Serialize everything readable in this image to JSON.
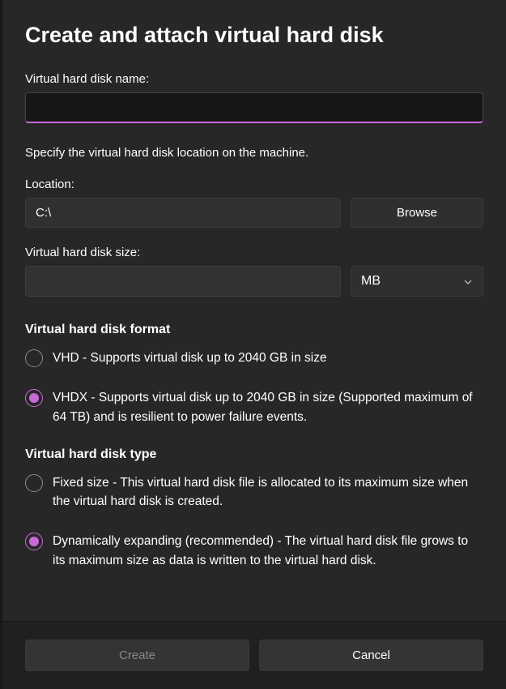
{
  "title": "Create and attach virtual hard disk",
  "nameField": {
    "label": "Virtual hard disk name:",
    "value": ""
  },
  "helperText": "Specify the virtual hard disk location on the machine.",
  "locationField": {
    "label": "Location:",
    "value": "C:\\",
    "browseLabel": "Browse"
  },
  "sizeField": {
    "label": "Virtual hard disk size:",
    "value": "",
    "unit": "MB"
  },
  "formatSection": {
    "title": "Virtual hard disk format",
    "options": [
      {
        "label": "VHD - Supports virtual disk up to 2040 GB in size",
        "selected": false
      },
      {
        "label": "VHDX - Supports virtual disk up to 2040 GB in size (Supported maximum of 64 TB) and is resilient to power failure events.",
        "selected": true
      }
    ]
  },
  "typeSection": {
    "title": "Virtual hard disk type",
    "options": [
      {
        "label": "Fixed size - This virtual hard disk file is allocated to its maximum size when the virtual hard disk is created.",
        "selected": false
      },
      {
        "label": "Dynamically expanding (recommended) - The virtual hard disk file grows to its maximum size as data is written to the virtual hard disk.",
        "selected": true
      }
    ]
  },
  "footer": {
    "create": "Create",
    "cancel": "Cancel"
  }
}
